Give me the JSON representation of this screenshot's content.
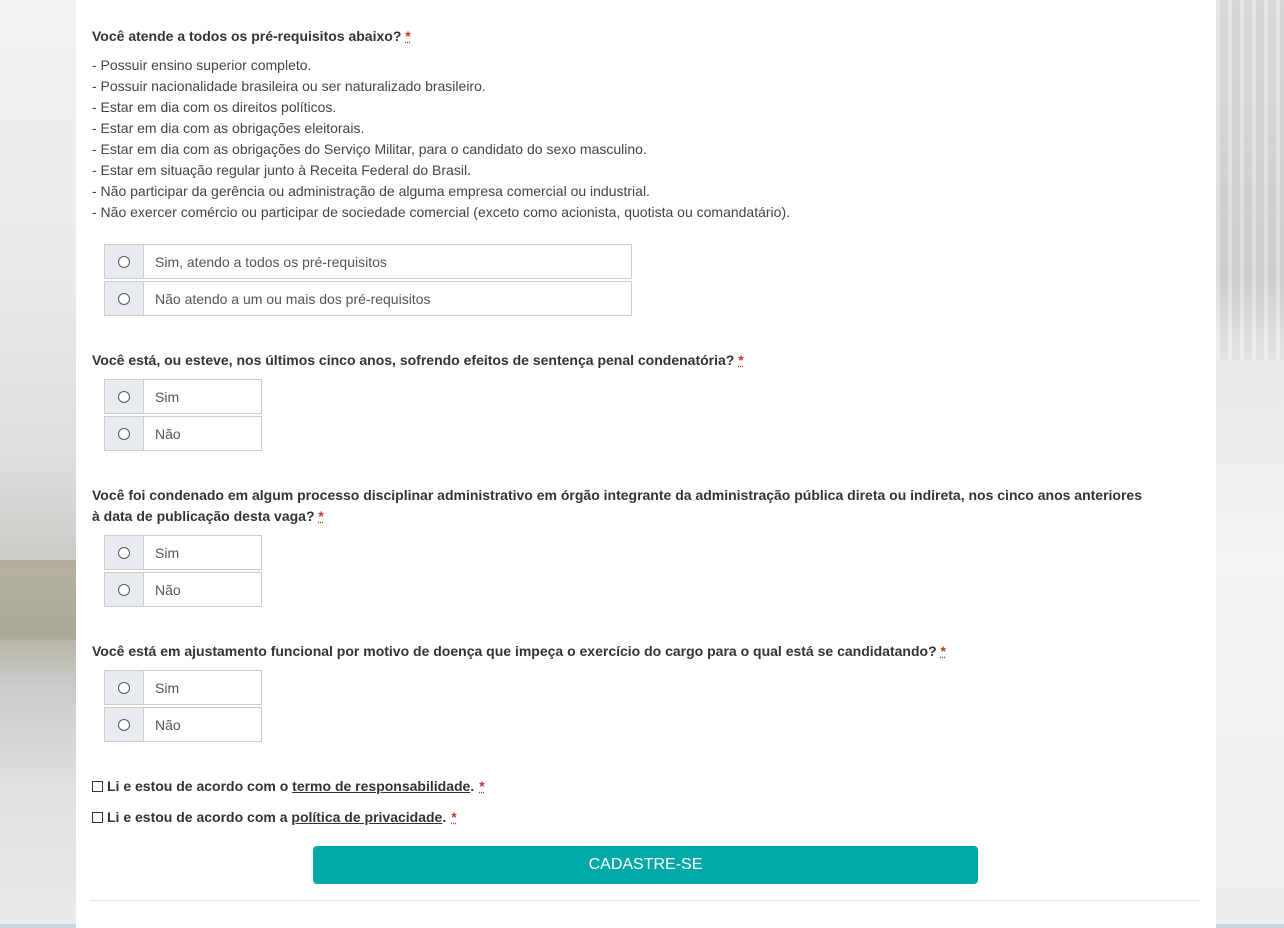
{
  "q1": {
    "title": "Você atende a todos os pré-requisitos abaixo?",
    "required": "*",
    "requirements": [
      "- Possuir ensino superior completo.",
      "- Possuir nacionalidade brasileira ou ser naturalizado brasileiro.",
      "- Estar em dia com os direitos políticos.",
      "- Estar em dia com as obrigações eleitorais.",
      "- Estar em dia com as obrigações do Serviço Militar, para o candidato do sexo masculino.",
      "- Estar em situação regular junto à Receita Federal do Brasil.",
      "- Não participar da gerência ou administração de alguma empresa comercial ou industrial.",
      "- Não exercer comércio ou participar de sociedade comercial (exceto como acionista, quotista ou comandatário)."
    ],
    "options": [
      "Sim, atendo a todos os pré-requisitos",
      "Não atendo a um ou mais dos pré-requisitos"
    ]
  },
  "q2": {
    "title": "Você está, ou esteve, nos últimos cinco anos, sofrendo efeitos de sentença penal condenatória?",
    "required": "*",
    "options": [
      "Sim",
      "Não"
    ]
  },
  "q3": {
    "title_line1": "Você foi condenado em algum processo disciplinar administrativo em órgão integrante da administração pública direta ou indireta, nos cinco anos anteriores",
    "title_line2": "à data de publicação desta vaga?",
    "required": "*",
    "options": [
      "Sim",
      "Não"
    ]
  },
  "q4": {
    "title": "Você está em ajustamento funcional por motivo de doença que impeça o exercício do cargo para o qual está se candidatando?",
    "required": "*",
    "options": [
      "Sim",
      "Não"
    ]
  },
  "terms": {
    "prefix": "Li e estou de acordo com o ",
    "link": "termo de responsabilidade",
    "suffix": ".",
    "required": "*"
  },
  "privacy": {
    "prefix": "Li e estou de acordo com a ",
    "link": "política de privacidade",
    "suffix": ".",
    "required": "*"
  },
  "submit_label": "CADASTRE-SE",
  "colors": {
    "accent": "#00a8a8",
    "required": "#c0392b"
  }
}
